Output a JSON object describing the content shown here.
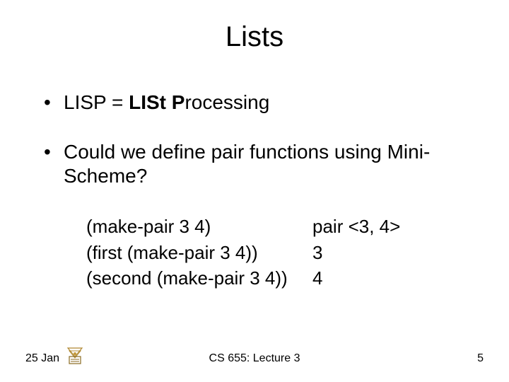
{
  "title": "Lists",
  "bullets": {
    "b1_prefix": "LISP = ",
    "b1_bold": "LISt P",
    "b1_suffix": "rocessing",
    "b2": "Could we define pair functions using Mini-Scheme?"
  },
  "examples": [
    {
      "left": "(make-pair 3 4)",
      "right": "pair <3, 4>"
    },
    {
      "left": "(first (make-pair 3 4))",
      "right": "3"
    },
    {
      "left": "(second (make-pair 3 4))",
      "right": "4"
    }
  ],
  "footer": {
    "date": "25 Jan",
    "center": "CS 655: Lecture 3",
    "page": "5"
  }
}
